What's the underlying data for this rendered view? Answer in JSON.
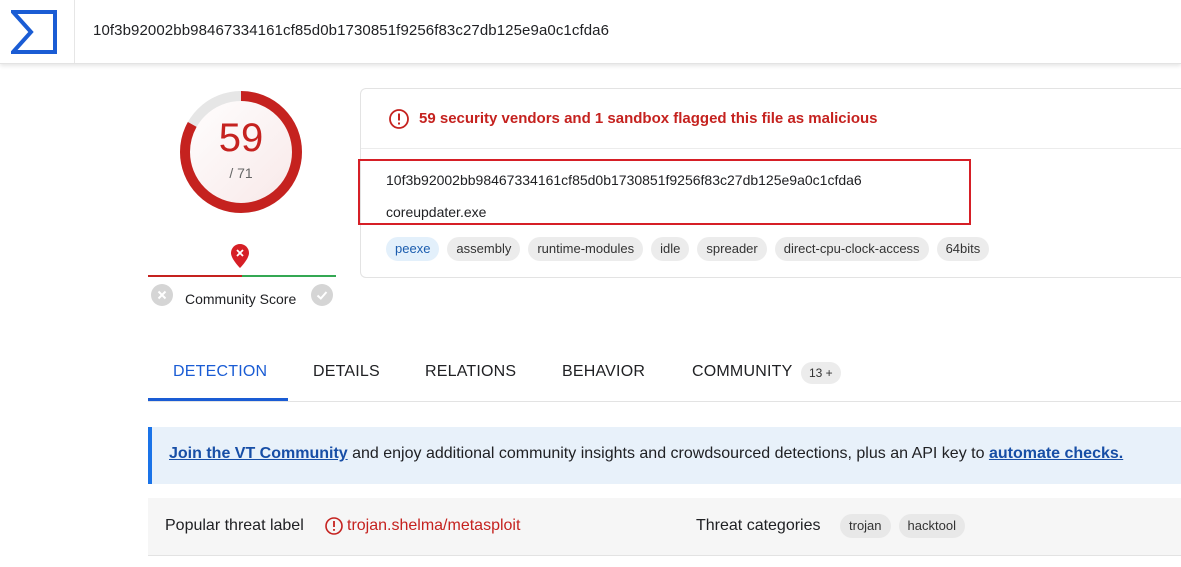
{
  "header": {
    "search_value": "10f3b92002bb98467334161cf85d0b1730851f9256f83c27db125e9a0c1cfda6"
  },
  "score": {
    "detected": "59",
    "total": "/ 71",
    "detection_ratio": 0.831
  },
  "community_score": {
    "label": "Community Score"
  },
  "summary": {
    "alert": "59 security vendors and 1 sandbox flagged this file as malicious",
    "hash": "10f3b92002bb98467334161cf85d0b1730851f9256f83c27db125e9a0c1cfda6",
    "filename": "coreupdater.exe",
    "tags": [
      "peexe",
      "assembly",
      "runtime-modules",
      "idle",
      "spreader",
      "direct-cpu-clock-access",
      "64bits"
    ]
  },
  "tabs": [
    {
      "label": "DETECTION",
      "active": true
    },
    {
      "label": "DETAILS",
      "active": false
    },
    {
      "label": "RELATIONS",
      "active": false
    },
    {
      "label": "BEHAVIOR",
      "active": false
    },
    {
      "label": "COMMUNITY",
      "active": false,
      "badge": "13 +"
    }
  ],
  "banner": {
    "link1": "Join the VT Community",
    "middle": " and enjoy additional community insights and crowdsourced detections, plus an API key to ",
    "link2": "automate checks."
  },
  "threat": {
    "popular_label_title": "Popular threat label",
    "popular_label_value": "trojan.shelma/metasploit",
    "categories_title": "Threat categories",
    "categories": [
      "trojan",
      "hacktool"
    ]
  },
  "colors": {
    "accent": "#1a5cd4",
    "malicious": "#c5221f",
    "banner_bg": "#e8f1fa"
  }
}
